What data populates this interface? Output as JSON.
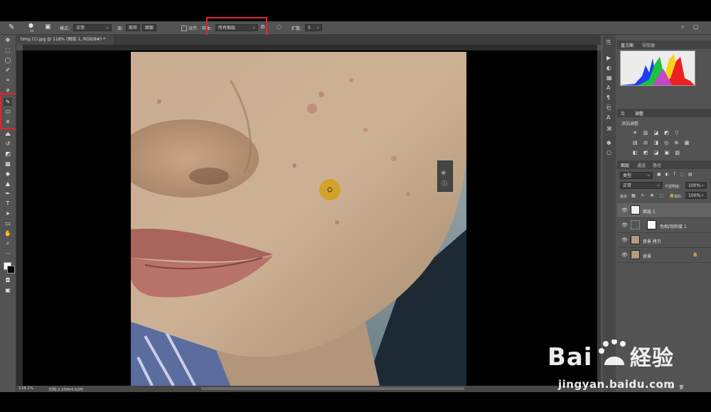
{
  "options_bar": {
    "tool_size": "34",
    "mode_label": "模式:",
    "mode_value": "正常",
    "source_label": "源:",
    "source_option_1": "取样",
    "source_option_2": "图案",
    "align_label": "对齐",
    "sample_label": "样本:",
    "sample_value": "所有图层",
    "diffusion_label": "扩散:",
    "diffusion_value": "5"
  },
  "document": {
    "tab_title": "timg (1).jpg @ 118% (图层 1, RGB/8#) *",
    "zoom": "118.1%",
    "doc_info": "文档:2.25M/4.62M"
  },
  "panels": {
    "histogram_tabs": [
      "直方图",
      "导航器"
    ],
    "adjust_tabs": [
      "库",
      "调整"
    ],
    "adjust_title": "添加调整",
    "layers_tabs": [
      "图层",
      "通道",
      "路径"
    ],
    "kind_filter": "类型",
    "blend_mode": "正常",
    "opacity_label": "不透明度:",
    "opacity_value": "100%",
    "lock_label": "锁定:",
    "fill_label": "填充:",
    "fill_value": "100%",
    "layers": [
      {
        "name": "图层 1"
      },
      {
        "name": "色相/饱和度 1"
      },
      {
        "name": "背景 拷贝"
      },
      {
        "name": "背景"
      }
    ]
  },
  "watermark": {
    "logo_text": "Bai経验",
    "url": "jingyan.baidu.com"
  },
  "colors": {
    "ui_gray": "#535353",
    "highlight_red": "#e5232a",
    "brush_cursor": "#d4a017"
  }
}
